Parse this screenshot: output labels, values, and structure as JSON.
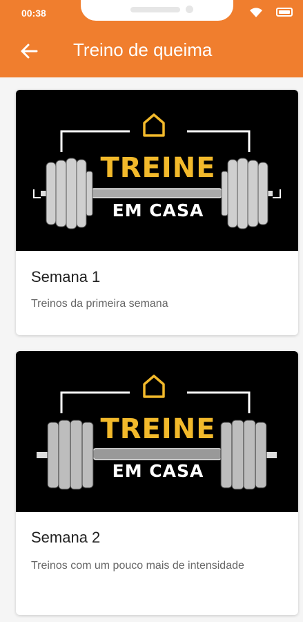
{
  "status_bar": {
    "time": "00:38"
  },
  "header": {
    "title": "Treino de queima"
  },
  "cards": [
    {
      "banner": {
        "line1": "TREINE",
        "line2": "EM CASA"
      },
      "title": "Semana 1",
      "subtitle": "Treinos da primeira semana"
    },
    {
      "banner": {
        "line1": "TREINE",
        "line2": "EM CASA"
      },
      "title": "Semana 2",
      "subtitle": "Treinos com um pouco mais de intensidade"
    }
  ],
  "colors": {
    "accent": "#f07e2e",
    "logo_yellow": "#f2b92b"
  }
}
